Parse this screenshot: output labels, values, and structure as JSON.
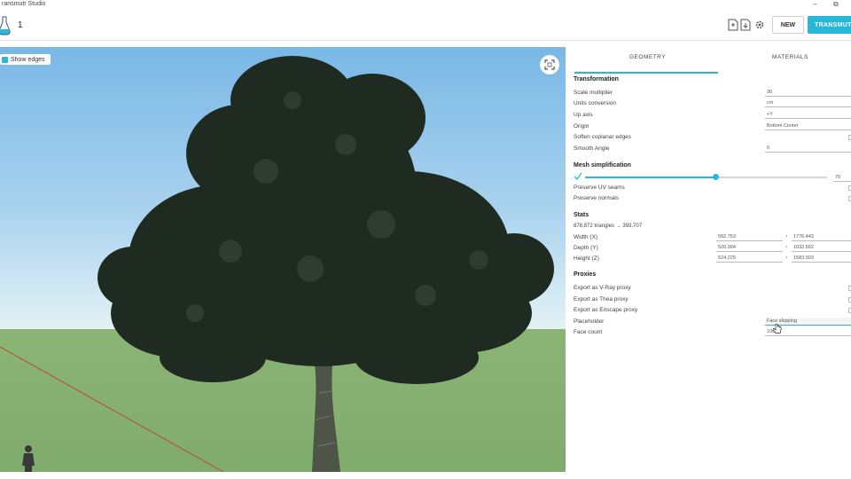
{
  "window": {
    "title": "ransmutr Studio",
    "minimize": "–",
    "restore": "⧉"
  },
  "toolbar": {
    "tab_number": "1",
    "new_label": "NEW",
    "transmute_label": "TRANSMUT"
  },
  "viewport": {
    "show_edges_label": "Show edges",
    "show_edges_checked": true
  },
  "panel": {
    "tabs": [
      {
        "label": "GEOMETRY",
        "active": true
      },
      {
        "label": "MATERIALS",
        "active": false
      }
    ],
    "transformation": {
      "title": "Transformation",
      "rows": [
        {
          "label": "Scale multiplier",
          "value": "30"
        },
        {
          "label": "Units conversion",
          "value": "cm"
        },
        {
          "label": "Up axis",
          "value": "+Y"
        },
        {
          "label": "Origin",
          "value": "Bottom Center"
        },
        {
          "label": "Soften coplanar edges",
          "value": ""
        },
        {
          "label": "Smooth Angle",
          "value": "0"
        }
      ]
    },
    "mesh": {
      "title": "Mesh simplification",
      "slider_value": "70",
      "slider_fraction": 0.54,
      "rows": [
        {
          "label": "Preserve UV seams"
        },
        {
          "label": "Preserve normals"
        }
      ]
    },
    "stats": {
      "title": "Stats",
      "triangles": "878,872 triangles → 393,707",
      "rows": [
        {
          "label": "Width (X)",
          "v1": "592.753",
          "v2": "1776.443"
        },
        {
          "label": "Depth (Y)",
          "v1": "520.994",
          "v2": "1032.562"
        },
        {
          "label": "Height (Z)",
          "v1": "524.225",
          "v2": "1583.003"
        }
      ]
    },
    "proxies": {
      "title": "Proxies",
      "rows": [
        {
          "label": "Export as V-Ray proxy"
        },
        {
          "label": "Export as Thea proxy"
        },
        {
          "label": "Export as Enscape proxy"
        },
        {
          "label": "Placeholder",
          "value": "Face skipping"
        },
        {
          "label": "Face count",
          "value": "100"
        }
      ]
    }
  },
  "colors": {
    "accent": "#26b7d9",
    "sky": "#79b8e6",
    "ground": "#8bb575",
    "foliage": "#1f2a20"
  }
}
